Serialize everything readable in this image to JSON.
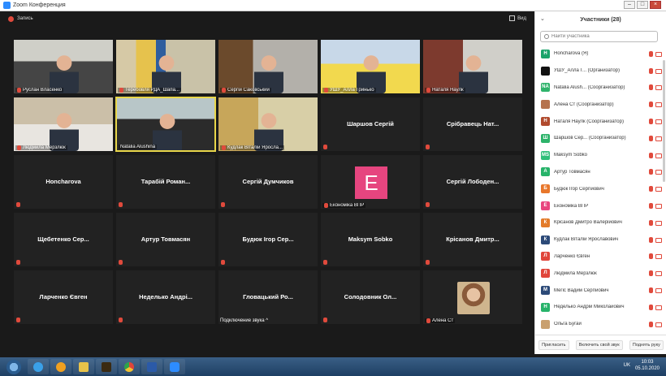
{
  "window": {
    "title": "Zoom Конференция"
  },
  "toolbar": {
    "record_label": "Запись",
    "view_label": "Вид"
  },
  "tiles": {
    "r1": [
      "Руслан Власенко",
      "Теребовля РДА_Шапа...",
      "Сергій Саковський",
      "УШУ_Алла Гринько",
      "Наталя Наулк"
    ],
    "r2": [
      "Людмила Мерзлюк",
      "Natalia Alushina",
      "Кудлак Віталій Яросла...",
      "Шаршов Сергій",
      "Срібравець Нат..."
    ],
    "r3": [
      "Honcharova",
      "Тарабій Роман...",
      "Сергій Думчиков",
      "Економіка ВПР",
      "Сергій Лободен...",
      "E"
    ],
    "r4": [
      "Щебетенко Сер...",
      "Артур Товмасян",
      "Будюк Ігор Сер...",
      "Maksym Sobko",
      "Крісанов Дмитр..."
    ],
    "r5": [
      "Ларченко Євген",
      "Неделько Андрі...",
      "Гловацький Ро...",
      "Солодовник Ол...",
      "Алена Ст"
    ],
    "connecting": "Подключение звука ^"
  },
  "panel": {
    "title": "Участники (28)",
    "search_placeholder": "Найти участника",
    "participants": [
      {
        "name": "Honcharova (Я)",
        "initial": "H",
        "color": "#1aa36a"
      },
      {
        "name": "УШУ_Алла Г... (Организатор)",
        "initial": "",
        "color": "#111111"
      },
      {
        "name": "Natalia Alush... (Соорганизатор)",
        "initial": "NA",
        "color": "#2fb36b"
      },
      {
        "name": "Алена Ст (Соорганизатор)",
        "initial": "",
        "color": "#b5734e"
      },
      {
        "name": "Наталя Наулк (Соорганизатор)",
        "initial": "Н",
        "color": "#b04a2d"
      },
      {
        "name": "Шаршов Сер... (Соорганизатор)",
        "initial": "Ш",
        "color": "#2db36a"
      },
      {
        "name": "Maksym Sobko",
        "initial": "MS",
        "color": "#2fbf7a"
      },
      {
        "name": "Артур Товмасян",
        "initial": "А",
        "color": "#27b36a"
      },
      {
        "name": "Будюк Ігор Сергійович",
        "initial": "Б",
        "color": "#e8772b"
      },
      {
        "name": "Економіка ВПР",
        "initial": "E",
        "color": "#e8457e"
      },
      {
        "name": "Крісанов Дмитро Валерійович",
        "initial": "К",
        "color": "#e37b2a"
      },
      {
        "name": "Кудлак Віталій Ярославович",
        "initial": "К",
        "color": "#2c4a78"
      },
      {
        "name": "Ларченко Євген",
        "initial": "Л",
        "color": "#e0453a"
      },
      {
        "name": "Людмила Мерзлюк",
        "initial": "Л",
        "color": "#e0453a"
      },
      {
        "name": "Мегіс Вадим Сергійович",
        "initial": "М",
        "color": "#2c4a78"
      },
      {
        "name": "Неделько Андрій Миколайович",
        "initial": "Н",
        "color": "#27b36a"
      },
      {
        "name": "Ольга Бугай",
        "initial": "",
        "color": "#c9a06f"
      }
    ],
    "footer": {
      "invite": "Пригласить",
      "unmute": "Включить свой звук",
      "raise": "Поднять руку"
    }
  },
  "taskbar": {
    "lang": "UK",
    "time": "10:03",
    "date": "05.10.2020"
  }
}
